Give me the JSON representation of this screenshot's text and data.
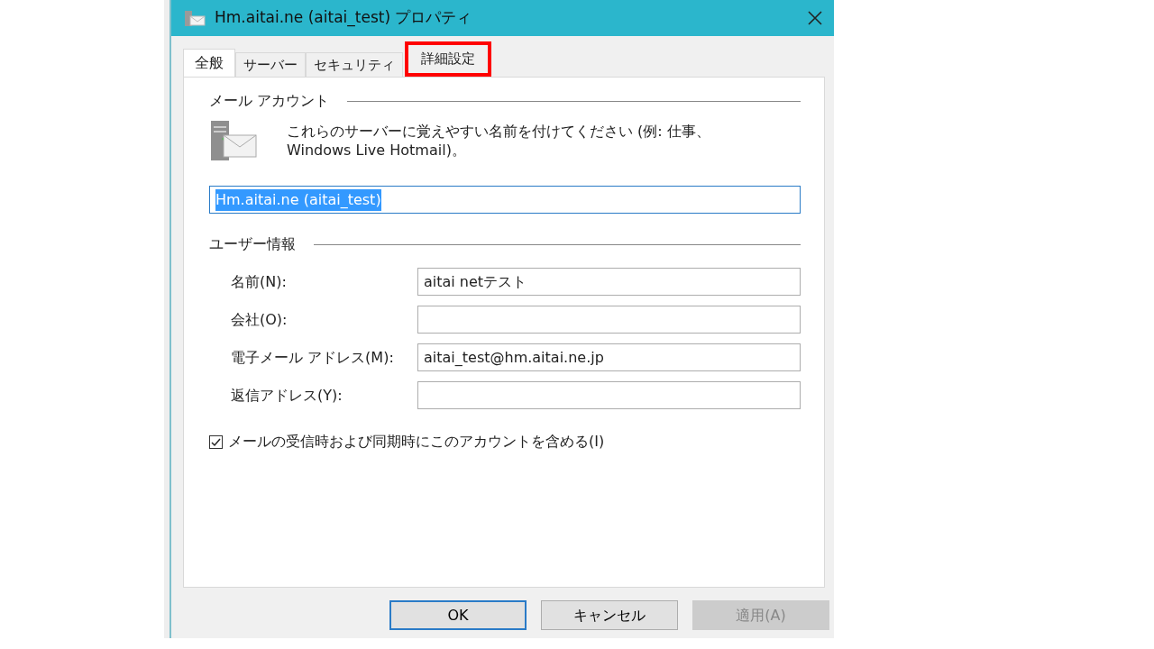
{
  "window": {
    "title": "Hm.aitai.ne (aitai_test) プロパティ"
  },
  "tabs": [
    {
      "label": "全般",
      "selected": true,
      "highlighted": false
    },
    {
      "label": "サーバー",
      "selected": false,
      "highlighted": false
    },
    {
      "label": "セキュリティ",
      "selected": false,
      "highlighted": false
    },
    {
      "label": "詳細設定",
      "selected": false,
      "highlighted": true
    }
  ],
  "mail_account": {
    "heading": "メール アカウント",
    "description": "これらのサーバーに覚えやすい名前を付けてください (例: 仕事、Windows Live Hotmail)。",
    "value": "Hm.aitai.ne (aitai_test)",
    "text_selected": true
  },
  "user_info": {
    "heading": "ユーザー情報",
    "fields": [
      {
        "label": "名前(N):",
        "value": "aitai netテスト"
      },
      {
        "label": "会社(O):"
      },
      {
        "label": "電子メール アドレス(M):",
        "value": "aitai_test@hm.aitai.ne.jp"
      },
      {
        "label": "返信アドレス(Y):"
      }
    ]
  },
  "include_checkbox": {
    "label": "メールの受信時および同期時にこのアカウントを含める(I)",
    "checked": true
  },
  "buttons": [
    {
      "label": "OK",
      "default": true,
      "disabled": false
    },
    {
      "label": "キャンセル",
      "default": false,
      "disabled": false
    },
    {
      "label": "適用(A)",
      "default": false,
      "disabled": true
    }
  ]
}
